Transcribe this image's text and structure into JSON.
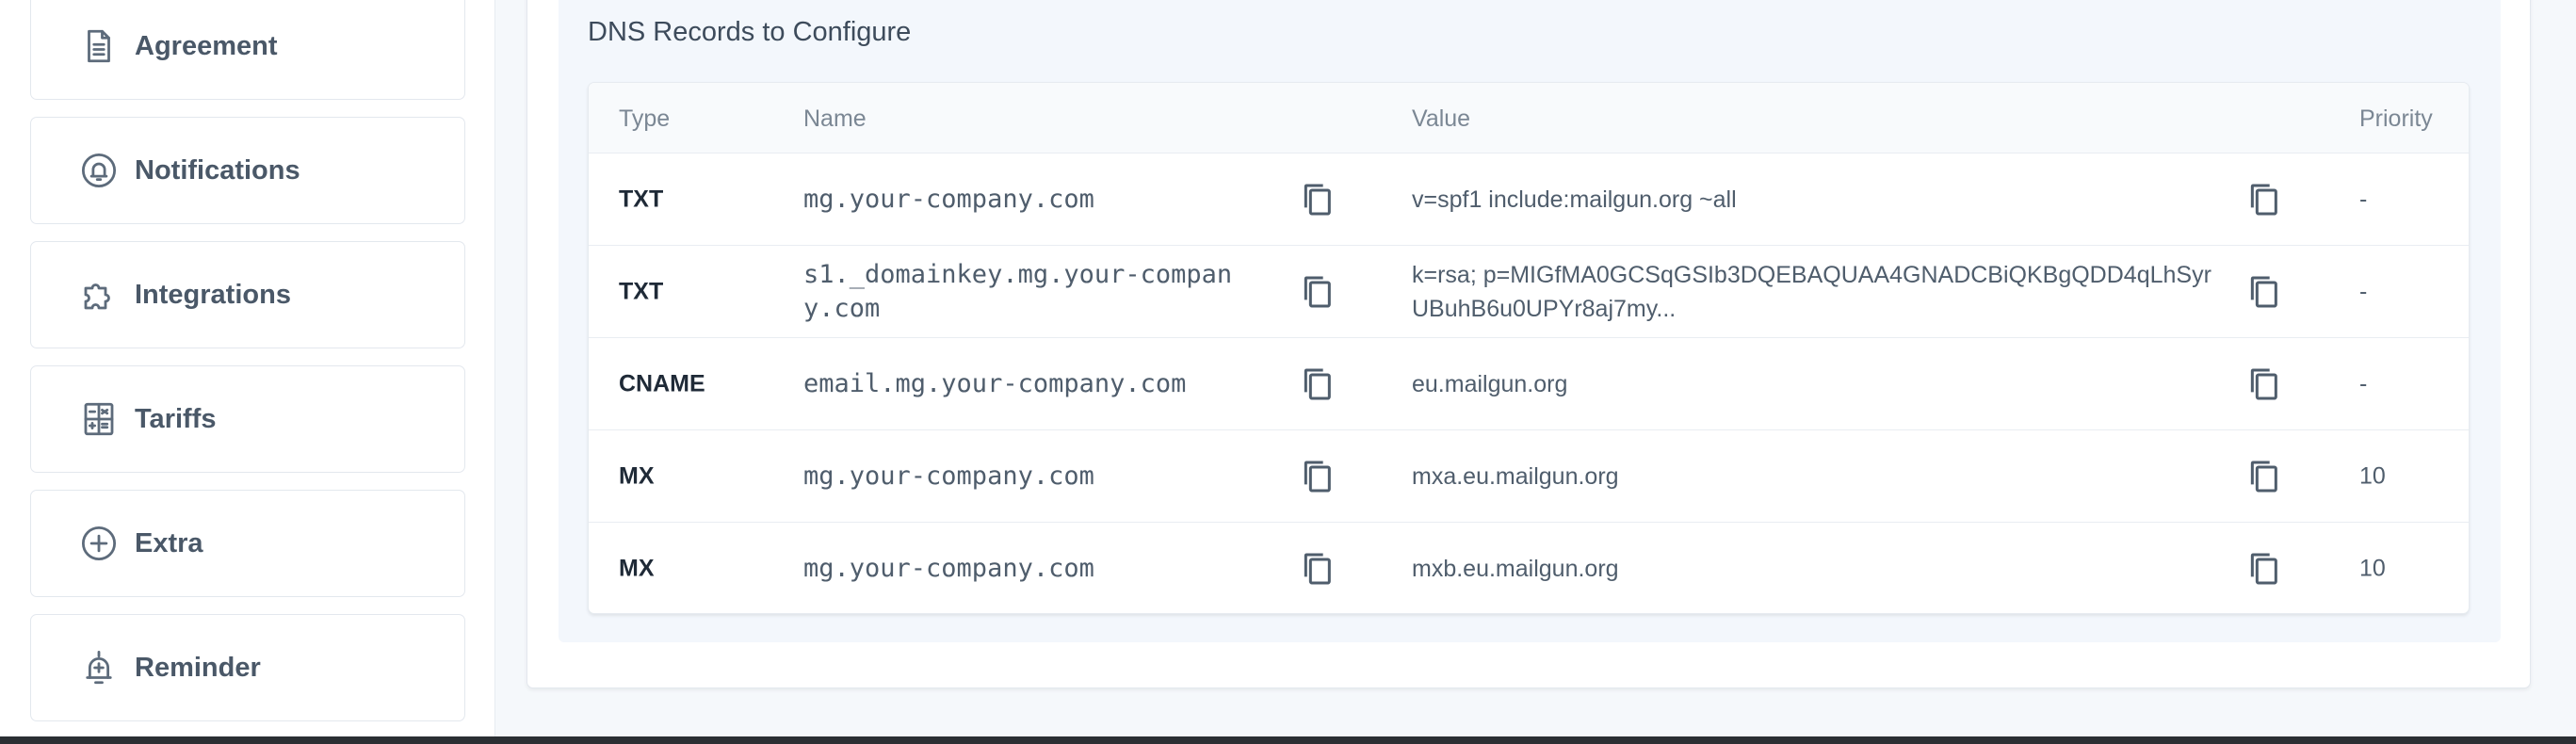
{
  "sidebar": {
    "items": [
      {
        "label": "Agreement",
        "icon": "document-icon"
      },
      {
        "label": "Notifications",
        "icon": "bell-icon"
      },
      {
        "label": "Integrations",
        "icon": "puzzle-icon"
      },
      {
        "label": "Tariffs",
        "icon": "calculator-icon"
      },
      {
        "label": "Extra",
        "icon": "plus-circle-icon"
      },
      {
        "label": "Reminder",
        "icon": "bell-plus-icon"
      }
    ]
  },
  "dns": {
    "title": "DNS Records to Configure",
    "columns": {
      "type": "Type",
      "name": "Name",
      "value": "Value",
      "priority": "Priority"
    },
    "records": [
      {
        "type": "TXT",
        "name": "mg.your-company.com",
        "value": "v=spf1 include:mailgun.org ~all",
        "priority": "-"
      },
      {
        "type": "TXT",
        "name": "s1._domainkey.mg.your-company.com",
        "value": "k=rsa; p=MIGfMA0GCSqGSIb3DQEBAQUAA4GNADCBiQKBgQDD4qLhSyrUBuhB6u0UPYr8aj7my...",
        "priority": "-"
      },
      {
        "type": "CNAME",
        "name": "email.mg.your-company.com",
        "value": "eu.mailgun.org",
        "priority": "-"
      },
      {
        "type": "MX",
        "name": "mg.your-company.com",
        "value": "mxa.eu.mailgun.org",
        "priority": "10"
      },
      {
        "type": "MX",
        "name": "mg.your-company.com",
        "value": "mxb.eu.mailgun.org",
        "priority": "10"
      }
    ]
  },
  "icons": {
    "copy": "copy-icon"
  },
  "colors": {
    "sidebar_text": "#4a5868",
    "section_bg": "#f3f7fc",
    "type_text": "#1f2a37"
  }
}
